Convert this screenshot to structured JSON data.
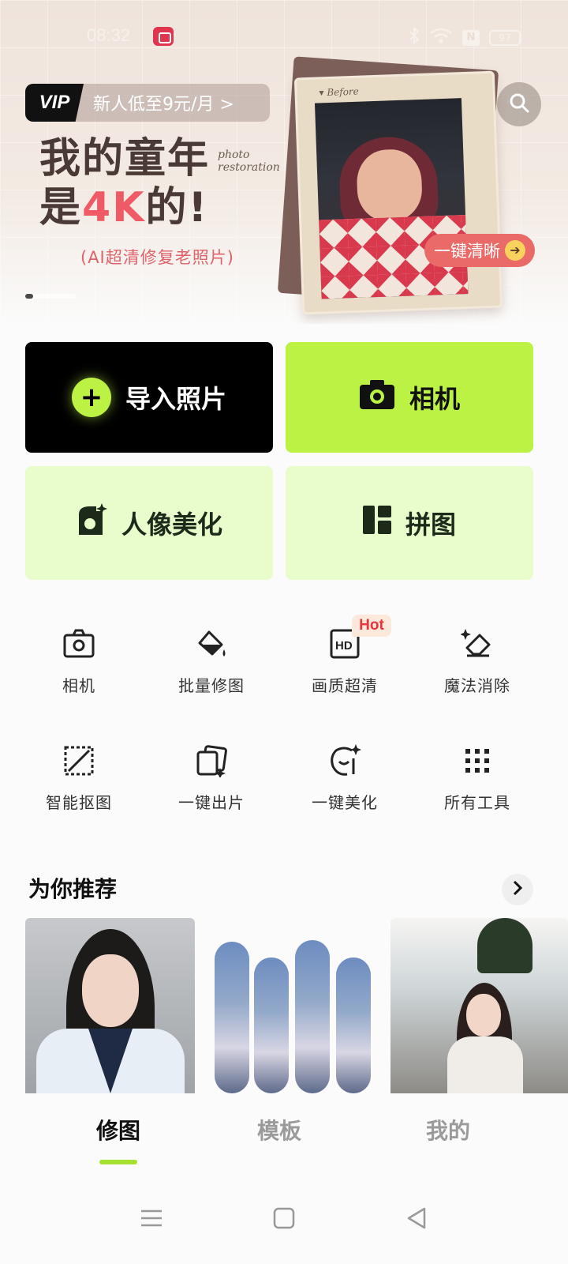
{
  "status_bar": {
    "time": "08:32",
    "battery": "97"
  },
  "banner": {
    "vip_tag": "VIP",
    "vip_offer": "新人低至9元/月 >",
    "headline_line1": "我的童年",
    "headline_line2_pre": "是",
    "headline_line2_accent": "4K",
    "headline_line2_post": "的!",
    "script_text_1": "photo",
    "script_text_2": "restoration",
    "subline": "(AI超清修复老照片)",
    "photo_label": "▾ Before",
    "enhance_button": "一键清晰",
    "enhance_arrow": "➔"
  },
  "actions": {
    "import": "导入照片",
    "camera": "相机",
    "portrait": "人像美化",
    "collage": "拼图"
  },
  "tools": [
    {
      "label": "相机",
      "icon": "camera-outline-icon"
    },
    {
      "label": "批量修图",
      "icon": "paint-bucket-icon"
    },
    {
      "label": "画质超清",
      "icon": "hd-icon",
      "badge": "Hot"
    },
    {
      "label": "魔法消除",
      "icon": "magic-eraser-icon"
    },
    {
      "label": "智能抠图",
      "icon": "smart-cutout-icon"
    },
    {
      "label": "一键出片",
      "icon": "one-tap-photo-icon"
    },
    {
      "label": "一键美化",
      "icon": "one-tap-beautify-icon"
    },
    {
      "label": "所有工具",
      "icon": "all-tools-grid-icon"
    }
  ],
  "recommend": {
    "title": "为你推荐"
  },
  "bottom_nav": {
    "tabs": [
      "修图",
      "模板",
      "我的"
    ],
    "active": "修图"
  },
  "colors": {
    "accent_lime": "#bbf244",
    "tile_pale": "#e9fccb",
    "hot_red": "#e8343c",
    "banner_coral": "#f05a67"
  }
}
